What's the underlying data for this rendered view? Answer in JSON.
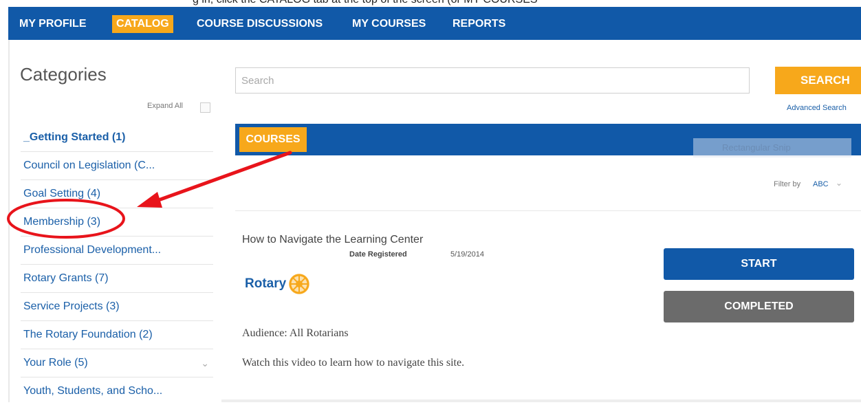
{
  "top_strip_text": "g in, click the CATALOG tab at the top of the screen (or MY COURSES",
  "nav": {
    "items": [
      {
        "label": "MY PROFILE",
        "active": false
      },
      {
        "label": "CATALOG",
        "active": true
      },
      {
        "label": "COURSE DISCUSSIONS",
        "active": false
      },
      {
        "label": "MY COURSES",
        "active": false
      },
      {
        "label": "REPORTS",
        "active": false
      }
    ]
  },
  "sidebar": {
    "title": "Categories",
    "expand_all": "Expand All",
    "items": [
      {
        "label": "_Getting Started (1)",
        "bold": true
      },
      {
        "label": "Council on Legislation (C..."
      },
      {
        "label": "Goal Setting (4)"
      },
      {
        "label": "Membership (3)",
        "highlighted": true
      },
      {
        "label": "Professional Development..."
      },
      {
        "label": "Rotary Grants (7)"
      },
      {
        "label": "Service Projects (3)"
      },
      {
        "label": "The Rotary Foundation (2)"
      },
      {
        "label": "Your Role (5)",
        "has_chevron": true
      },
      {
        "label": "Youth, Students, and Scho..."
      }
    ]
  },
  "search": {
    "placeholder": "Search",
    "value": "",
    "button_label": "SEARCH",
    "advanced_label": "Advanced Search"
  },
  "courses": {
    "tab_label": "COURSES",
    "snip_overlay_label": "Rectangular Snip",
    "filter_label": "Filter by",
    "filter_value": "ABC"
  },
  "course": {
    "title": "How to Navigate the Learning Center",
    "date_label": "Date Registered",
    "date_value": "5/19/2014",
    "logo_text": "Rotary",
    "audience": "Audience: All Rotarians",
    "description": "Watch this video to learn how to navigate this site.",
    "start_label": "START",
    "completed_label": "COMPLETED"
  },
  "colors": {
    "nav_blue": "#1159a8",
    "accent_gold": "#f7a81b",
    "link_blue": "#1a5fa8",
    "completed_gray": "#6b6b6b",
    "annotation_red": "#e8141b"
  },
  "icons": {
    "expand_checkbox": "checkbox-icon",
    "your_role_chevron": "chevron-down-icon",
    "filter_chevron": "chevron-down-icon",
    "rotary_logo": "rotary-wheel-icon",
    "annotation": "red-arrow-and-circle"
  }
}
